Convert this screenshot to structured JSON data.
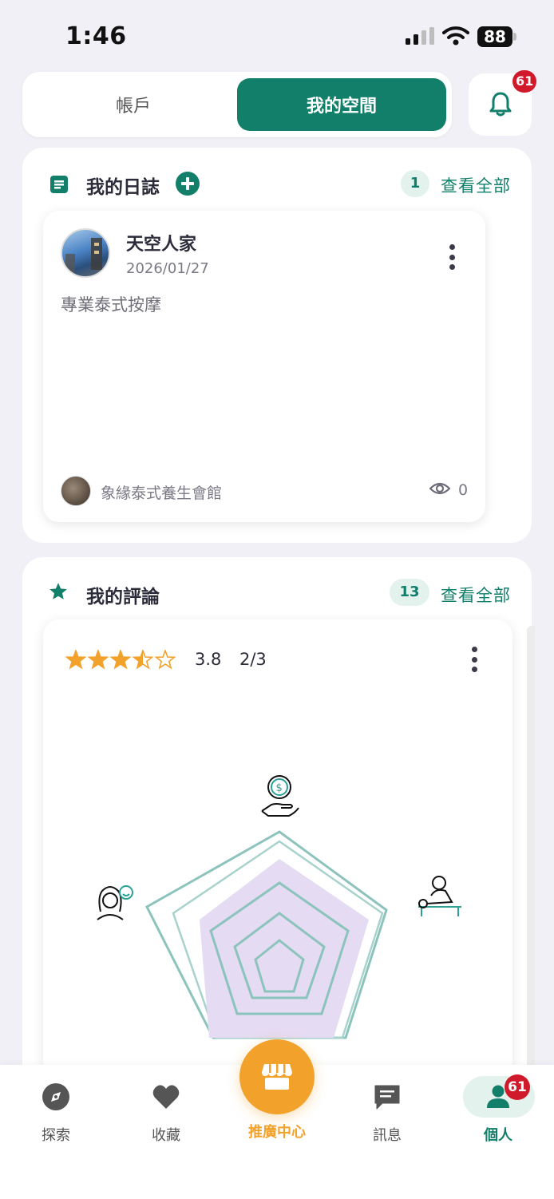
{
  "status_bar": {
    "time": "1:46",
    "battery": "88"
  },
  "tabs": {
    "account": "帳戶",
    "my_space": "我的空間"
  },
  "notifications": {
    "count": "61"
  },
  "diary_section": {
    "title": "我的日誌",
    "count": "1",
    "view_all": "查看全部",
    "card": {
      "author": "天空人家",
      "date": "2026/01/27",
      "text": "專業泰式按摩",
      "shop": "象緣泰式養生會館",
      "views": "0"
    }
  },
  "review_section": {
    "title": "我的評論",
    "count": "13",
    "view_all": "查看全部",
    "card": {
      "rating": "3.8",
      "page": "2/3",
      "stars_value": 3.5
    }
  },
  "bottom_nav": {
    "explore": "探索",
    "favorites": "收藏",
    "promo": "推廣中心",
    "messages": "訊息",
    "profile": "個人",
    "profile_badge": "61"
  },
  "colors": {
    "brand": "#127f6a",
    "accent": "#f2a22b",
    "badge": "#d0192a"
  }
}
